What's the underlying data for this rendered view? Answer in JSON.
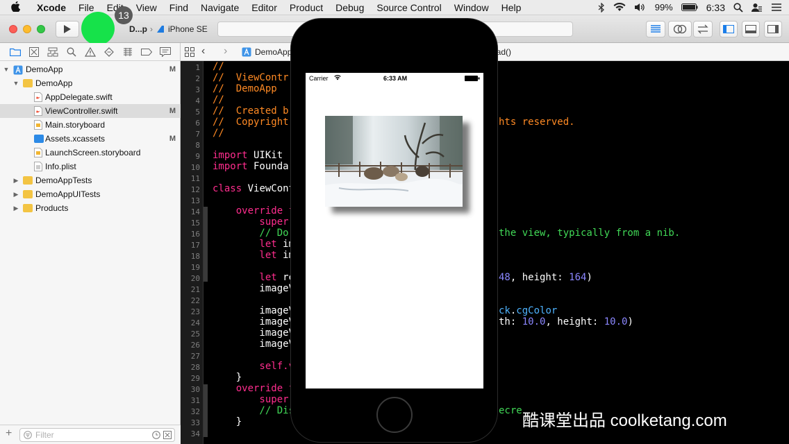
{
  "menubar": {
    "apple": "",
    "app": "Xcode",
    "items": [
      "File",
      "Edit",
      "View",
      "Find",
      "Navigate",
      "Editor",
      "Product",
      "Debug",
      "Source Control",
      "Window",
      "Help"
    ],
    "battery": "99%",
    "time": "6:33"
  },
  "toolbar": {
    "badge": "13",
    "scheme": "D...p",
    "device": "iPhone SE"
  },
  "jumpbar": {
    "project": "DemoApp",
    "method_tail": "oad()"
  },
  "navigator": {
    "filter_placeholder": "Filter",
    "items": [
      {
        "label": "DemoApp",
        "status": "M"
      },
      {
        "label": "DemoApp",
        "status": ""
      },
      {
        "label": "AppDelegate.swift",
        "status": ""
      },
      {
        "label": "ViewController.swift",
        "status": "M"
      },
      {
        "label": "Main.storyboard",
        "status": ""
      },
      {
        "label": "Assets.xcassets",
        "status": "M"
      },
      {
        "label": "LaunchScreen.storyboard",
        "status": ""
      },
      {
        "label": "Info.plist",
        "status": ""
      },
      {
        "label": "DemoAppTests",
        "status": ""
      },
      {
        "label": "DemoAppUITests",
        "status": ""
      },
      {
        "label": "Products",
        "status": ""
      }
    ]
  },
  "editor": {
    "line_numbers": [
      "1",
      "2",
      "3",
      "4",
      "5",
      "6",
      "7",
      "8",
      "9",
      "10",
      "11",
      "12",
      "13",
      "14",
      "15",
      "16",
      "17",
      "18",
      "19",
      "20",
      "21",
      "22",
      "23",
      "24",
      "25",
      "26",
      "27",
      "28",
      "29",
      "30",
      "31",
      "32",
      "33",
      "34"
    ],
    "code": {
      "l1": "//",
      "l2": "//  ViewContr",
      "l3": "//  DemoApp",
      "l4": "//",
      "l5": "//  Created b",
      "l6a": "//  Copyright",
      "l6b": "hts reserved.",
      "l7": "//",
      "l9a": "import",
      "l9b": " UIKit",
      "l10a": "import",
      "l10b": " Founda",
      "l12a": "class",
      "l12b": " ViewCont",
      "l14": "    override f",
      "l15": "        super.",
      "l16a": "        // Do",
      "l16b": "the view, typically from a nib.",
      "l17a": "        let",
      "l17b": " im",
      "l18a": "        let",
      "l18b": " im",
      "l20a": "        let",
      "l20b": " re",
      "l20c": "48",
      "l20d": ", height: ",
      "l20e": "164",
      "l20f": ")",
      "l21": "        imageV",
      "l23a": "        imageV",
      "l23b": "ck",
      "l23c": ".",
      "l23d": "cgColor",
      "l24a": "        imageV",
      "l24b": "th: ",
      "l24c": "10.0",
      "l24d": ", height: ",
      "l24e": "10.0",
      "l24f": ")",
      "l25": "        imageV",
      "l26": "        imageV",
      "l28": "        self.v",
      "l29": "    }",
      "l30": "    override f",
      "l31": "        super.",
      "l32a": "        // Dis",
      "l32b": "ecre",
      "l33": "    }"
    }
  },
  "simulator": {
    "carrier": "Carrier",
    "time": "6:33 AM"
  },
  "watermark": "酷课堂出品 coolketang.com",
  "colors": {
    "comment": "#ff8a24",
    "keyword": "#ff2d8e",
    "number": "#8b87ff",
    "type": "#4eb3ff",
    "green_comment": "#41d957",
    "touch": "#16e24a"
  }
}
